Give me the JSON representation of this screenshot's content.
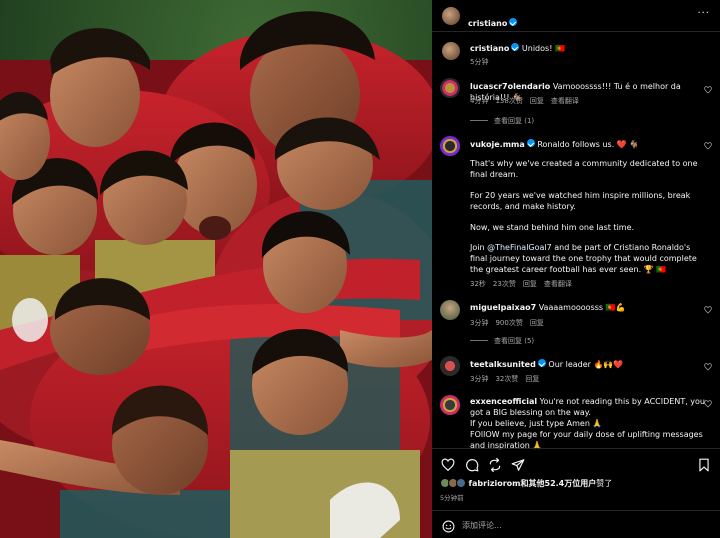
{
  "header": {
    "username": "cristiano"
  },
  "caption": {
    "username": "cristiano",
    "text": "Unidos! 🇵🇹",
    "time": "5分钟"
  },
  "comments": [
    {
      "username": "lucascr7olendario",
      "text": "Vamooossss!!! Tu é o melhor da história!!! 🐐",
      "time": "4分钟",
      "likes": "138次赞",
      "reply": "回复",
      "translate": "查看翻译",
      "thread": "查看回复 (1)"
    },
    {
      "username": "vukoje.mma",
      "text_intro": "Ronaldo follows us. ❤️ 🐐",
      "p1": "That's why we've created a community dedicated to one final dream.",
      "p2": "For 20 years we've watched him inspire millions, break records, and make history.",
      "p3": "Now, we stand behind him one last time.",
      "p4_pre": "Join ",
      "p4_link": "@TheFinalGoal7",
      "p4_post": " and be part of Cristiano Ronaldo's final journey toward the one trophy that would complete the greatest career football has ever seen. 🏆 🇵🇹",
      "time": "32秒",
      "likes": "23次赞",
      "reply": "回复",
      "translate": "查看翻译"
    },
    {
      "username": "miguelpaixao7",
      "text": "Vaaaamoooosss 🇵🇹💪",
      "time": "3分钟",
      "likes": "900次赞",
      "reply": "回复",
      "thread": "查看回复 (5)"
    },
    {
      "username": "teetalksunited",
      "text": "Our leader 🔥🙌❤️",
      "time": "3分钟",
      "likes": "32次赞",
      "reply": "回复"
    },
    {
      "username": "exxenceofficial",
      "l1": "You're not reading this by ACCIDENT, you got a BIG blessing on the way.",
      "l2": "If you believe, just type Amen 🙏",
      "l3": "FOllOW my page for your daily dose of uplifting messages and inspiration 🙏"
    }
  ],
  "actions": {
    "likes_user": "fabriziorom",
    "likes_rest": "和其他52.4万位用户",
    "likes_suffix": "赞了",
    "time": "5分钟前"
  },
  "add_comment": {
    "placeholder": "添加评论..."
  },
  "icons": [
    "like-icon",
    "comment-icon",
    "share-icon",
    "send-icon",
    "save-icon",
    "emoji-icon",
    "verified-icon"
  ],
  "colors": {
    "verified": "#0095f6",
    "background": "#000000",
    "secondary_text": "#a8a8a8",
    "heart": "#ff3040"
  }
}
